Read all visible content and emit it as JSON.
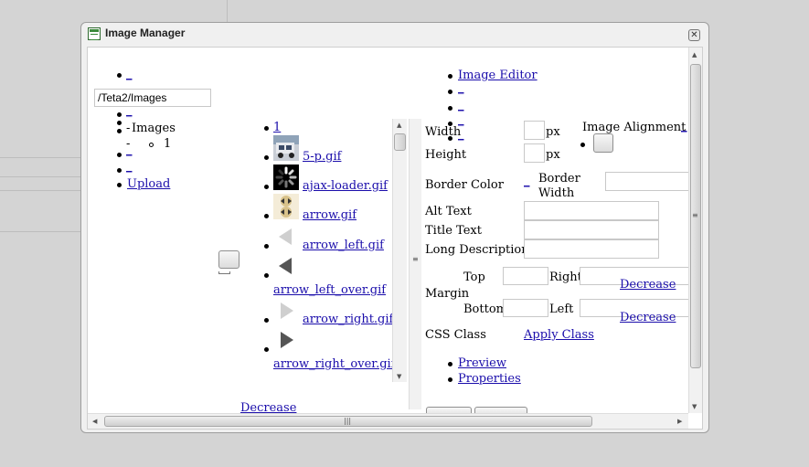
{
  "window": {
    "title": "Image Manager",
    "close_glyph": "✕"
  },
  "folders": {
    "path_value": "/Teta2/Images",
    "bullet_link_1": "_",
    "bullet_link_2": "_",
    "tree_root": "Images",
    "tree_expander": "-",
    "tree_child": "1",
    "tree_child_expander": "-",
    "bullet_link_3": "_",
    "bullet_link_4": "_",
    "upload_label": "Upload"
  },
  "files": {
    "folder_item": "1",
    "items": [
      {
        "name": "5-p.gif"
      },
      {
        "name": "ajax-loader.gif"
      },
      {
        "name": "arrow.gif"
      },
      {
        "name": "arrow_left.gif"
      },
      {
        "name": "arrow_left_over.gif"
      },
      {
        "name": "arrow_right.gif"
      },
      {
        "name": "arrow_right_over.gif"
      }
    ],
    "decrease_label": "Decrease"
  },
  "props": {
    "image_editor": "Image Editor",
    "bullet_links": [
      "_",
      "_",
      "_",
      "_"
    ],
    "width_label": "Width",
    "height_label": "Height",
    "px_label_1": "px",
    "px_label_2": "px",
    "image_alignment_label": "Image Alignment",
    "alignment_link": "_",
    "border_color_label": "Border Color",
    "border_color_link": "_",
    "border_width_label": "Border Width",
    "alt_text_label": "Alt Text",
    "title_text_label": "Title Text",
    "long_description_label": "Long Description",
    "margin_label": "Margin",
    "top_label": "Top",
    "right_label": "Right",
    "bottom_label": "Bottom",
    "left_label": "Left",
    "decrease_label_1": "Decrease",
    "decrease_label_2": "Decrease",
    "css_class_label": "CSS Class",
    "apply_class_label": "Apply Class",
    "preview_label": "Preview",
    "properties_label": "Properties"
  },
  "colors": {
    "link": "#1a0dab",
    "background": "#d4d4d4",
    "window": "#f0f0f0"
  }
}
